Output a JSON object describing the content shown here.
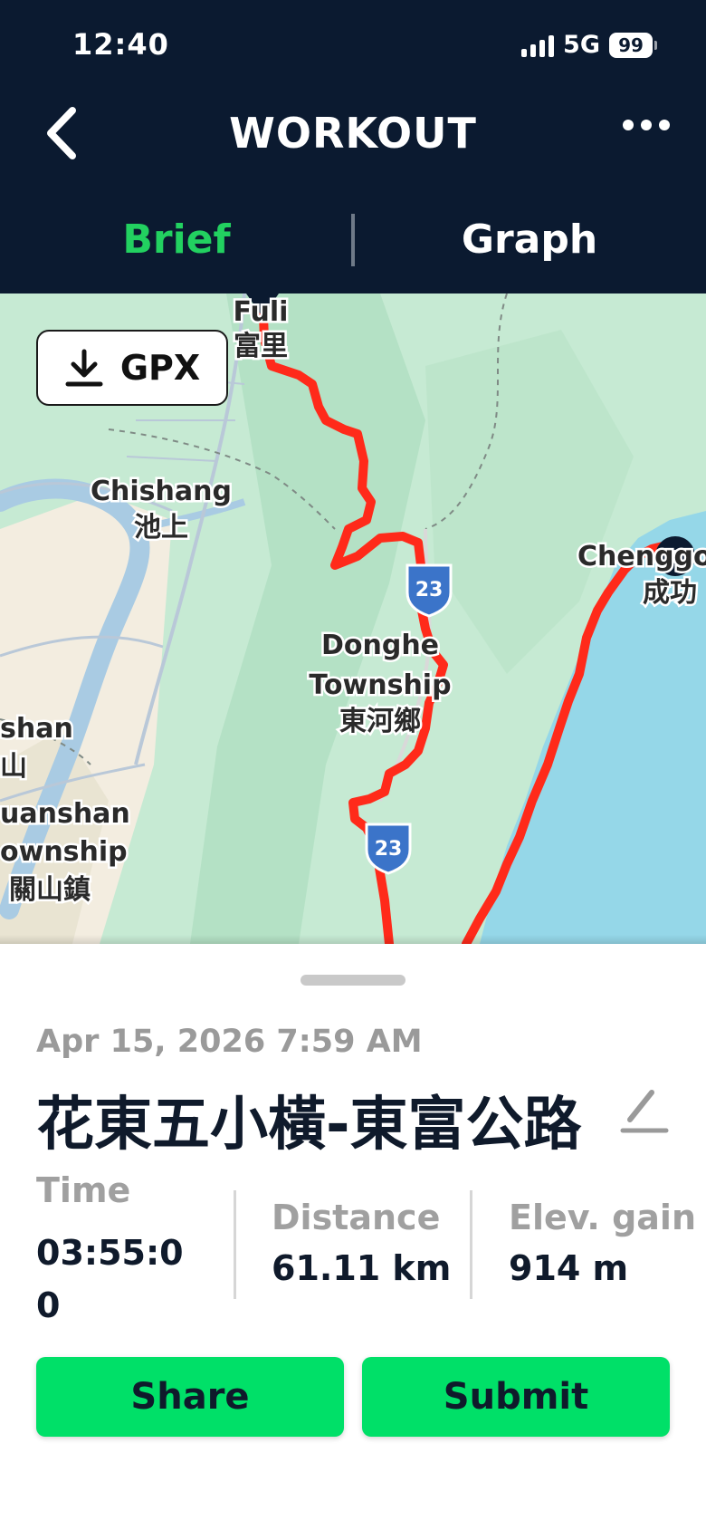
{
  "status": {
    "time": "12:40",
    "network": "5G",
    "battery": "99"
  },
  "nav": {
    "title": "WORKOUT"
  },
  "tabs": [
    {
      "label": "Brief"
    },
    {
      "label": "Graph"
    }
  ],
  "map": {
    "gpx_label": "GPX",
    "places": {
      "fuli_en": "Fuli",
      "fuli_zh": "富里",
      "chishang_en": "Chishang",
      "chishang_zh": "池上",
      "chenggong_en": "Chenggong",
      "chenggong_zh": "成功",
      "donghe_en1": "Donghe",
      "donghe_en2": "Township",
      "donghe_zh": "東河鄉",
      "haiduan_en": "shan",
      "haiduan_zh": "山",
      "guanshan_en1": "uanshan",
      "guanshan_en2": "ownship",
      "guanshan_zh": "關山鎮",
      "route_no": "23"
    }
  },
  "workout": {
    "date": "Apr 15, 2026 7:59 AM",
    "title": "花東五小橫-東富公路",
    "stats": {
      "time_label": "Time",
      "time_value": "03:55:00",
      "distance_label": "Distance",
      "distance_value": "61.11 km",
      "elev_label": "Elev. gain",
      "elev_value": "914 m"
    }
  },
  "actions": {
    "share": "Share",
    "submit": "Submit"
  },
  "colors": {
    "header_bg": "#0b1a30",
    "accent_green": "#22d160",
    "button_green": "#00e068",
    "route_red": "#ff2a1a"
  }
}
